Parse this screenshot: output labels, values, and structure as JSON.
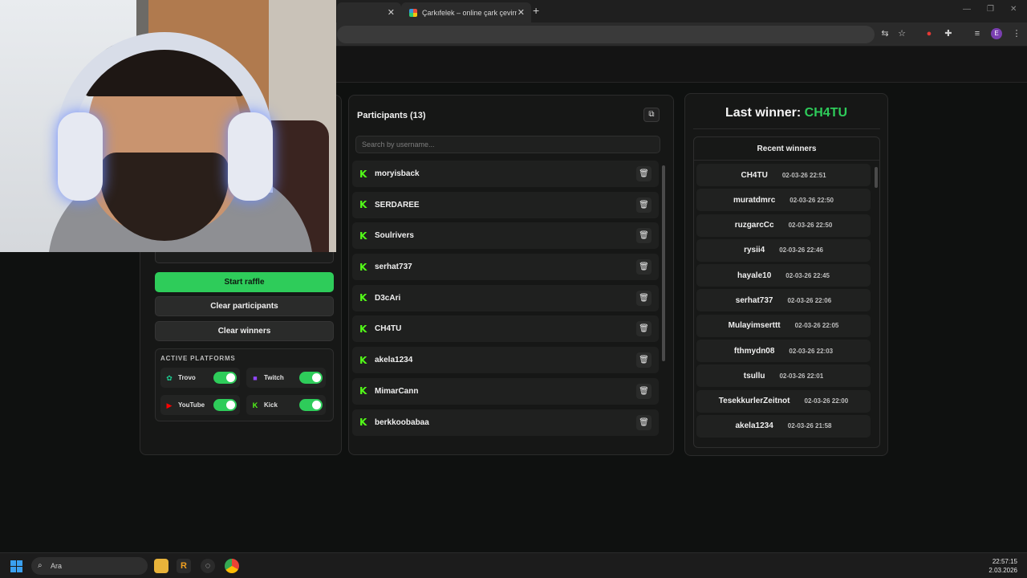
{
  "browser": {
    "tabs": [
      {
        "label": ""
      },
      {
        "label": "Çarkıfelek – online çark çevirme"
      }
    ],
    "new_tab_glyph": "+",
    "profile_initial": "E"
  },
  "controls": {
    "start_raffle": "Start raffle",
    "clear_participants": "Clear participants",
    "clear_winners": "Clear winners"
  },
  "platforms": {
    "title": "ACTIVE PLATFORMS",
    "items": [
      {
        "name": "Trovo",
        "enabled": true,
        "color": "#1cd193",
        "icon": "trovo-icon"
      },
      {
        "name": "Twitch",
        "enabled": true,
        "color": "#9146ff",
        "icon": "twitch-icon"
      },
      {
        "name": "YouTube",
        "enabled": true,
        "color": "#ff0000",
        "icon": "youtube-icon"
      },
      {
        "name": "Kick",
        "enabled": true,
        "color": "#53fc18",
        "icon": "kick-icon"
      }
    ]
  },
  "participants": {
    "title": "Participants (13)",
    "search_placeholder": "Search by username...",
    "items": [
      {
        "name": "moryisback"
      },
      {
        "name": "SERDAREE"
      },
      {
        "name": "Soulrivers"
      },
      {
        "name": "serhat737"
      },
      {
        "name": "D3cAri"
      },
      {
        "name": "CH4TU"
      },
      {
        "name": "akela1234"
      },
      {
        "name": "MimarCann"
      },
      {
        "name": "berkkoobabaa"
      }
    ]
  },
  "winner": {
    "label": "Last winner:",
    "name": "CH4TU"
  },
  "recent_winners": {
    "title": "Recent winners",
    "items": [
      {
        "name": "CH4TU",
        "date": "02-03-26 22:51"
      },
      {
        "name": "muratdmrc",
        "date": "02-03-26 22:50"
      },
      {
        "name": "ruzgarcCc",
        "date": "02-03-26 22:50"
      },
      {
        "name": "rysii4",
        "date": "02-03-26 22:46"
      },
      {
        "name": "hayale10",
        "date": "02-03-26 22:45"
      },
      {
        "name": "serhat737",
        "date": "02-03-26 22:06"
      },
      {
        "name": "Mulayimserttt",
        "date": "02-03-26 22:05"
      },
      {
        "name": "fthmydn08",
        "date": "02-03-26 22:03"
      },
      {
        "name": "tsullu",
        "date": "02-03-26 22:01"
      },
      {
        "name": "TesekkurlerZeitnot",
        "date": "02-03-26 22:00"
      },
      {
        "name": "akela1234",
        "date": "02-03-26 21:58"
      }
    ]
  },
  "taskbar": {
    "search_placeholder": "Ara",
    "time": "22:57:15",
    "date": "2.03.2026"
  },
  "colors": {
    "accent": "#2ecc5a",
    "kick": "#53fc18",
    "background": "#0f1110",
    "panel": "#161716"
  }
}
